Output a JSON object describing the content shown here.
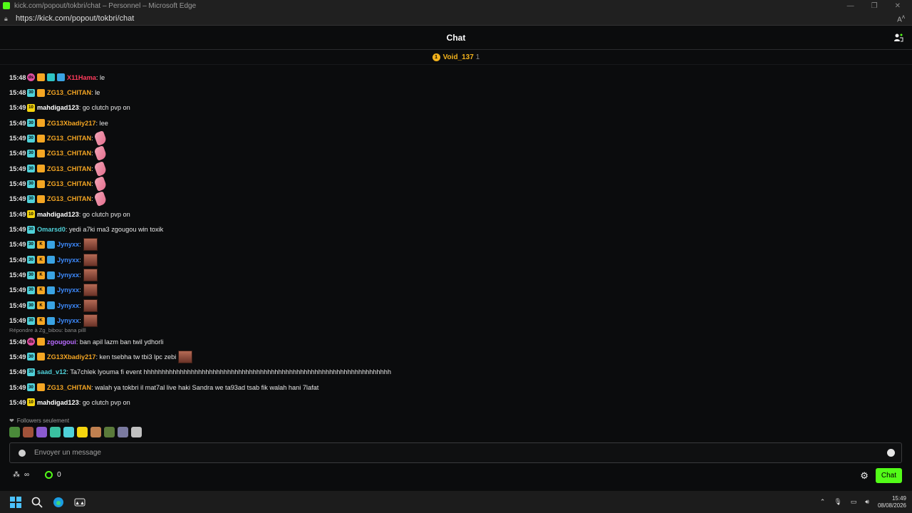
{
  "window": {
    "title": "kick.com/popout/tokbri/chat – Personnel – Microsoft Edge",
    "url": "https://kick.com/popout/tokbri/chat"
  },
  "header": {
    "title": "Chat"
  },
  "pinned": {
    "name": "Void_137",
    "count": "1",
    "medal": "1"
  },
  "messages": [
    {
      "time": "15:48",
      "badges": [
        "pink",
        "crown",
        "twin",
        "verified"
      ],
      "user": "X11Hama",
      "color": "#ff3b5c",
      "text": ": le",
      "emote": ""
    },
    {
      "time": "15:48",
      "badges": [
        "sub",
        "crown"
      ],
      "user": "ZG13_CHITAN",
      "color": "#f5a623",
      "text": ": le",
      "emote": ""
    },
    {
      "time": "15:49",
      "badges": [
        "gold"
      ],
      "user": "mahdigad123",
      "color": "#ffffff",
      "text": ": go clutch pvp on",
      "emote": ""
    },
    {
      "time": "15:49",
      "badges": [
        "sub",
        "crown"
      ],
      "user": "ZG13Xbadiy217",
      "color": "#f5a623",
      "text": ": lee",
      "emote": ""
    },
    {
      "time": "15:49",
      "badges": [
        "sub",
        "crown"
      ],
      "user": "ZG13_CHITAN",
      "color": "#f5a623",
      "text": ":",
      "emote": "fist"
    },
    {
      "time": "15:49",
      "badges": [
        "sub",
        "crown"
      ],
      "user": "ZG13_CHITAN",
      "color": "#f5a623",
      "text": ":",
      "emote": "fist"
    },
    {
      "time": "15:49",
      "badges": [
        "sub",
        "crown"
      ],
      "user": "ZG13_CHITAN",
      "color": "#f5a623",
      "text": ":",
      "emote": "fist"
    },
    {
      "time": "15:49",
      "badges": [
        "sub",
        "crown"
      ],
      "user": "ZG13_CHITAN",
      "color": "#f5a623",
      "text": ":",
      "emote": "fist"
    },
    {
      "time": "15:49",
      "badges": [
        "sub",
        "crown"
      ],
      "user": "ZG13_CHITAN",
      "color": "#f5a623",
      "text": ":",
      "emote": "fist"
    },
    {
      "time": "15:49",
      "badges": [
        "gold"
      ],
      "user": "mahdigad123",
      "color": "#ffffff",
      "text": ": go clutch pvp on",
      "emote": ""
    },
    {
      "time": "15:49",
      "badges": [
        "sub"
      ],
      "user": "Omarsd0",
      "color": "#4fd1d9",
      "text": ": yedi a7ki ma3 zgougou win toxik",
      "emote": ""
    },
    {
      "time": "15:49",
      "badges": [
        "sub",
        "k",
        "verified"
      ],
      "user": "Jynyxx",
      "color": "#3d8bff",
      "text": ":",
      "emote": "face"
    },
    {
      "time": "15:49",
      "badges": [
        "sub",
        "k",
        "verified"
      ],
      "user": "Jynyxx",
      "color": "#3d8bff",
      "text": ":",
      "emote": "face"
    },
    {
      "time": "15:49",
      "badges": [
        "sub",
        "k",
        "verified"
      ],
      "user": "Jynyxx",
      "color": "#3d8bff",
      "text": ":",
      "emote": "face"
    },
    {
      "time": "15:49",
      "badges": [
        "sub",
        "k",
        "verified"
      ],
      "user": "Jynyxx",
      "color": "#3d8bff",
      "text": ":",
      "emote": "face"
    },
    {
      "time": "15:49",
      "badges": [
        "sub",
        "k",
        "verified"
      ],
      "user": "Jynyxx",
      "color": "#3d8bff",
      "text": ":",
      "emote": "face"
    },
    {
      "time": "15:49",
      "badges": [
        "sub",
        "k",
        "verified"
      ],
      "user": "Jynyxx",
      "color": "#3d8bff",
      "text": ":",
      "emote": "face"
    },
    {
      "reply": "Répondre à Zg_bibou: bana pilll",
      "time": "15:49",
      "badges": [
        "pink",
        "crown"
      ],
      "user": "zgougoui",
      "color": "#b86bff",
      "text": ": ban apil lazm ban twil ydhorli",
      "emote": ""
    },
    {
      "time": "15:49",
      "badges": [
        "sub",
        "crown"
      ],
      "user": "ZG13Xbadiy217",
      "color": "#f5a623",
      "text": ": ken tsebha tw tbi3 lpc zebi",
      "emote": "face"
    },
    {
      "time": "15:49",
      "badges": [
        "sub"
      ],
      "user": "saad_v12",
      "color": "#4fd1d9",
      "text": ": Ta7chlek lyouma fi event hhhhhhhhhhhhhhhhhhhhhhhhhhhhhhhhhhhhhhhhhhhhhhhhhhhhhhhhhhhhhhhhhhhh",
      "emote": ""
    },
    {
      "time": "15:49",
      "badges": [
        "sub",
        "crown"
      ],
      "user": "ZG13_CHITAN",
      "color": "#f5a623",
      "text": ": walah ya tokbri il mat7al live haki Sandra we ta93ad tsab fik walah hani 7lafat",
      "emote": ""
    },
    {
      "time": "15:49",
      "badges": [
        "gold"
      ],
      "user": "mahdigad123",
      "color": "#ffffff",
      "text": ": go clutch pvp on",
      "emote": ""
    }
  ],
  "badge_text": {
    "sub": "30",
    "gold": "10",
    "pink": "ds",
    "crown": "",
    "k": "K",
    "verified": "",
    "twin": ""
  },
  "followers_label": "Followers seulement",
  "emote_colors": [
    "#4a8a3a",
    "#a0523a",
    "#8a5ad0",
    "#3ac0a0",
    "#4fd1d9",
    "#f4d40e",
    "#c08050",
    "#5a7a3a",
    "#7a7aa0",
    "#c0c0c0"
  ],
  "input": {
    "placeholder": "Envoyer un message"
  },
  "bottom": {
    "infinity": "∞",
    "points": "0",
    "chat_button": "Chat"
  },
  "taskbar": {
    "time": "15:49",
    "date": "08/08/2026"
  }
}
